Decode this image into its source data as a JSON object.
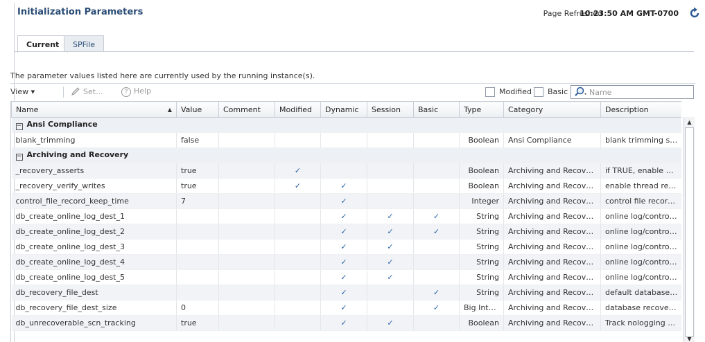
{
  "header": {
    "title": "Initialization Parameters",
    "refresh_label": "Page Refreshed",
    "refresh_time": "10:23:50 AM GMT-0700"
  },
  "tabs": [
    {
      "label": "Current",
      "active": true
    },
    {
      "label": "SPFile",
      "active": false
    }
  ],
  "info_text": "The parameter values listed here are currently used by the running instance(s).",
  "toolbar": {
    "view_label": "View ▾",
    "set_label": "Set...",
    "help_label": "Help",
    "modified_label": "Modified",
    "basic_label": "Basic",
    "search_placeholder": "Name"
  },
  "columns": [
    "Name",
    "Value",
    "Comment",
    "Modified",
    "Dynamic",
    "Session",
    "Basic",
    "Type",
    "Category",
    "Description"
  ],
  "check_glyph": "✓",
  "groups": [
    {
      "label": "Ansi Compliance",
      "rows": [
        {
          "name": "blank_trimming",
          "value": "false",
          "comment": "",
          "modified": false,
          "dynamic": false,
          "session": false,
          "basic": false,
          "type": "Boolean",
          "category": "Ansi Compliance",
          "description": "blank trimming sem..."
        }
      ]
    },
    {
      "label": "Archiving and Recovery",
      "rows": [
        {
          "name": "_recovery_asserts",
          "value": "true",
          "comment": "",
          "modified": true,
          "dynamic": false,
          "session": false,
          "basic": false,
          "type": "Boolean",
          "category": "Archiving and Recovery",
          "description": "if TRUE, enable ex..."
        },
        {
          "name": "_recovery_verify_writes",
          "value": "true",
          "comment": "",
          "modified": true,
          "dynamic": true,
          "session": false,
          "basic": false,
          "type": "Boolean",
          "category": "Archiving and Recovery",
          "description": "enable thread reco..."
        },
        {
          "name": "control_file_record_keep_time",
          "value": "7",
          "comment": "",
          "modified": false,
          "dynamic": true,
          "session": false,
          "basic": false,
          "type": "Integer",
          "category": "Archiving and Recovery",
          "description": "control file record ..."
        },
        {
          "name": "db_create_online_log_dest_1",
          "value": "",
          "comment": "",
          "modified": false,
          "dynamic": true,
          "session": true,
          "basic": true,
          "type": "String",
          "category": "Archiving and Recovery",
          "description": "online log/controlfil..."
        },
        {
          "name": "db_create_online_log_dest_2",
          "value": "",
          "comment": "",
          "modified": false,
          "dynamic": true,
          "session": true,
          "basic": true,
          "type": "String",
          "category": "Archiving and Recovery",
          "description": "online log/controlfil..."
        },
        {
          "name": "db_create_online_log_dest_3",
          "value": "",
          "comment": "",
          "modified": false,
          "dynamic": true,
          "session": true,
          "basic": false,
          "type": "String",
          "category": "Archiving and Recovery",
          "description": "online log/controlfil..."
        },
        {
          "name": "db_create_online_log_dest_4",
          "value": "",
          "comment": "",
          "modified": false,
          "dynamic": true,
          "session": true,
          "basic": false,
          "type": "String",
          "category": "Archiving and Recovery",
          "description": "online log/controlfil..."
        },
        {
          "name": "db_create_online_log_dest_5",
          "value": "",
          "comment": "",
          "modified": false,
          "dynamic": true,
          "session": true,
          "basic": false,
          "type": "String",
          "category": "Archiving and Recovery",
          "description": "online log/controlfil..."
        },
        {
          "name": "db_recovery_file_dest",
          "value": "",
          "comment": "",
          "modified": false,
          "dynamic": true,
          "session": false,
          "basic": true,
          "type": "String",
          "category": "Archiving and Recovery",
          "description": "default database r..."
        },
        {
          "name": "db_recovery_file_dest_size",
          "value": "0",
          "comment": "",
          "modified": false,
          "dynamic": true,
          "session": false,
          "basic": true,
          "type": "Big Integer",
          "category": "Archiving and Recovery",
          "description": "database recovery..."
        },
        {
          "name": "db_unrecoverable_scn_tracking",
          "value": "true",
          "comment": "",
          "modified": false,
          "dynamic": true,
          "session": true,
          "basic": false,
          "type": "Boolean",
          "category": "Archiving and Recovery",
          "description": "Track nologging SC..."
        }
      ]
    }
  ]
}
